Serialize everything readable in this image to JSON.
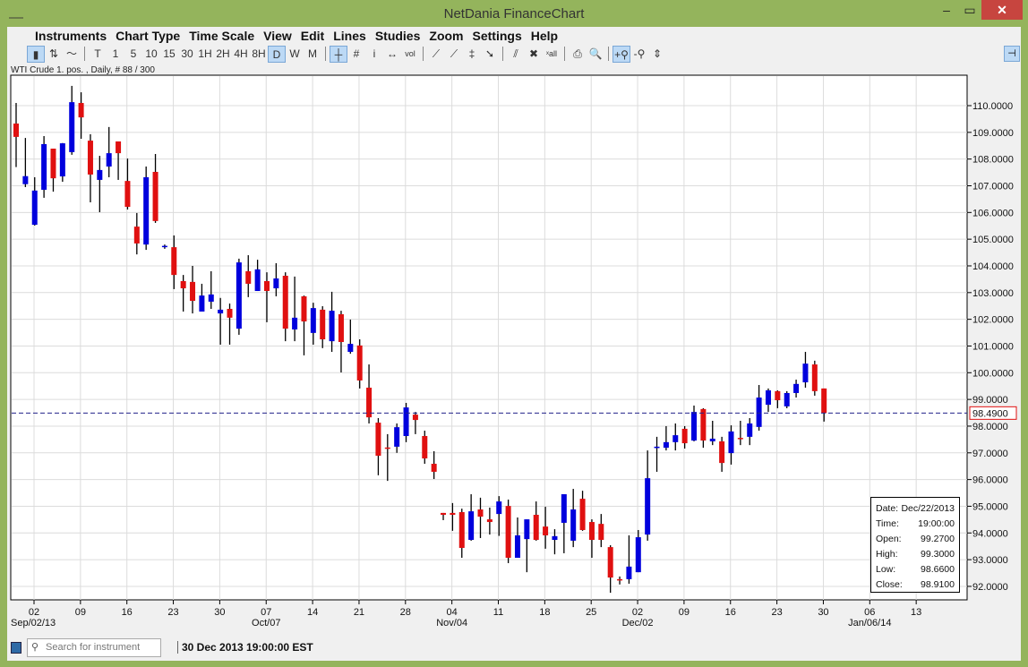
{
  "window": {
    "title": "NetDania FinanceChart",
    "minimize": "–",
    "maximize": "▭",
    "close": "✕"
  },
  "menu": [
    "Instruments",
    "Chart Type",
    "Time Scale",
    "View",
    "Edit",
    "Lines",
    "Studies",
    "Zoom",
    "Settings",
    "Help"
  ],
  "toolbar": {
    "chart_types": [
      {
        "icon": "candlestick-icon",
        "glyph": "▮",
        "on": true
      },
      {
        "icon": "bar-chart-icon",
        "glyph": "⇅"
      },
      {
        "icon": "line-chart-icon",
        "glyph": "〜"
      }
    ],
    "time_scales": [
      {
        "label": "T"
      },
      {
        "label": "1"
      },
      {
        "label": "5"
      },
      {
        "label": "10"
      },
      {
        "label": "15"
      },
      {
        "label": "30"
      },
      {
        "label": "1H"
      },
      {
        "label": "2H"
      },
      {
        "label": "4H"
      },
      {
        "label": "8H"
      },
      {
        "label": "D",
        "on": true
      },
      {
        "label": "W"
      },
      {
        "label": "M"
      }
    ],
    "tools": [
      {
        "icon": "crosshair-icon",
        "glyph": "┼",
        "on": true
      },
      {
        "icon": "grid-icon",
        "glyph": "#"
      },
      {
        "icon": "info-icon",
        "glyph": "i"
      },
      {
        "icon": "scroll-icon",
        "glyph": "↔"
      },
      {
        "icon": "volume-icon",
        "glyph": "vol"
      }
    ],
    "lines": [
      {
        "icon": "trendline-icon",
        "glyph": "⟋"
      },
      {
        "icon": "channel-icon",
        "glyph": "⟋"
      },
      {
        "icon": "fibonacci-icon",
        "glyph": "‡"
      },
      {
        "icon": "arrow-icon",
        "glyph": "➘"
      }
    ],
    "edit": [
      {
        "icon": "line-style-icon",
        "glyph": "⫽"
      },
      {
        "icon": "delete-icon",
        "glyph": "✖"
      },
      {
        "icon": "delete-all-icon",
        "glyph": "ˣall"
      }
    ],
    "view": [
      {
        "icon": "print-icon",
        "glyph": "⎙"
      },
      {
        "icon": "print-preview-icon",
        "glyph": "🔍"
      }
    ],
    "zoom": [
      {
        "icon": "zoom-in-icon",
        "glyph": "+⚲",
        "on": true
      },
      {
        "icon": "zoom-out-icon",
        "glyph": "-⚲"
      },
      {
        "icon": "fit-icon",
        "glyph": "⇕"
      }
    ]
  },
  "status_line": "WTI Crude 1. pos. , Daily, # 88 / 300",
  "chart_data": {
    "type": "candlestick",
    "instrument": "WTI Crude 1. pos.",
    "ohlc_format": [
      "open",
      "high",
      "low",
      "close"
    ],
    "candles": [
      [
        109.33,
        110.1,
        107.7,
        108.83
      ],
      [
        107.06,
        108.79,
        106.95,
        107.36
      ],
      [
        105.54,
        107.32,
        105.51,
        106.82
      ],
      [
        106.85,
        108.86,
        106.55,
        108.56
      ],
      [
        108.39,
        108.39,
        106.78,
        107.28
      ],
      [
        107.35,
        108.6,
        107.15,
        108.59
      ],
      [
        108.26,
        110.74,
        108.16,
        110.13
      ],
      [
        110.1,
        110.5,
        108.76,
        109.56
      ],
      [
        108.69,
        108.93,
        106.38,
        107.42
      ],
      [
        107.22,
        108.12,
        106.01,
        107.59
      ],
      [
        107.72,
        109.2,
        107.32,
        108.22
      ],
      [
        108.66,
        108.66,
        107.22,
        108.22
      ],
      [
        107.18,
        108.02,
        106.11,
        106.21
      ],
      [
        105.47,
        105.98,
        104.43,
        104.84
      ],
      [
        104.8,
        107.72,
        104.6,
        107.32
      ],
      [
        107.52,
        108.19,
        105.61,
        105.68
      ],
      [
        104.73,
        104.8,
        104.64,
        104.75
      ],
      [
        104.7,
        105.14,
        103.13,
        103.66
      ],
      [
        103.43,
        103.66,
        102.29,
        103.16
      ],
      [
        103.4,
        104.0,
        102.22,
        102.69
      ],
      [
        102.29,
        103.33,
        102.29,
        102.89
      ],
      [
        102.66,
        103.8,
        102.39,
        102.93
      ],
      [
        102.22,
        102.8,
        101.05,
        102.36
      ],
      [
        102.39,
        102.59,
        101.05,
        102.06
      ],
      [
        101.65,
        104.27,
        101.42,
        104.13
      ],
      [
        103.8,
        104.4,
        102.83,
        103.33
      ],
      [
        103.06,
        104.23,
        103.06,
        103.87
      ],
      [
        103.43,
        103.76,
        101.89,
        103.06
      ],
      [
        103.16,
        104.1,
        102.86,
        103.53
      ],
      [
        103.63,
        103.76,
        101.18,
        101.65
      ],
      [
        101.62,
        103.6,
        101.18,
        102.06
      ],
      [
        102.86,
        102.89,
        100.65,
        101.92
      ],
      [
        101.49,
        102.62,
        101.05,
        102.42
      ],
      [
        102.36,
        102.49,
        100.92,
        101.25
      ],
      [
        101.18,
        103.03,
        100.78,
        102.32
      ],
      [
        102.19,
        102.32,
        100.01,
        101.15
      ],
      [
        100.78,
        101.99,
        100.71,
        101.08
      ],
      [
        101.02,
        101.25,
        99.41,
        99.71
      ],
      [
        99.44,
        100.31,
        98.1,
        98.33
      ],
      [
        98.13,
        98.3,
        96.16,
        96.89
      ],
      [
        97.2,
        97.7,
        95.95,
        97.18
      ],
      [
        97.23,
        98.1,
        97.0,
        97.96
      ],
      [
        97.63,
        98.87,
        97.4,
        98.7
      ],
      [
        98.43,
        98.53,
        97.7,
        98.23
      ],
      [
        97.63,
        97.83,
        96.59,
        96.79
      ],
      [
        96.59,
        97.06,
        96.02,
        96.29
      ],
      [
        94.75,
        94.75,
        94.48,
        94.68
      ],
      [
        94.75,
        95.12,
        94.08,
        94.68
      ],
      [
        94.78,
        94.91,
        93.07,
        93.44
      ],
      [
        93.74,
        95.45,
        93.71,
        94.81
      ],
      [
        94.88,
        95.32,
        93.81,
        94.61
      ],
      [
        94.51,
        94.95,
        93.94,
        94.41
      ],
      [
        94.71,
        95.38,
        93.89,
        95.18
      ],
      [
        95.01,
        95.25,
        92.87,
        93.07
      ],
      [
        93.07,
        94.58,
        93.07,
        93.91
      ],
      [
        93.77,
        94.51,
        92.53,
        94.51
      ],
      [
        94.68,
        95.18,
        93.71,
        93.74
      ],
      [
        94.24,
        94.98,
        93.41,
        93.91
      ],
      [
        93.74,
        94.14,
        93.2,
        93.88
      ],
      [
        94.38,
        95.45,
        93.24,
        95.45
      ],
      [
        93.71,
        95.65,
        93.47,
        94.88
      ],
      [
        95.28,
        95.58,
        94.08,
        94.11
      ],
      [
        94.41,
        94.51,
        93.07,
        93.74
      ],
      [
        94.34,
        94.71,
        93.47,
        93.74
      ],
      [
        93.47,
        93.54,
        91.76,
        92.33
      ],
      [
        92.27,
        92.37,
        92.07,
        92.25
      ],
      [
        92.27,
        93.91,
        92.1,
        92.74
      ],
      [
        92.53,
        94.11,
        92.53,
        93.84
      ],
      [
        93.94,
        97.09,
        93.71,
        96.05
      ],
      [
        97.2,
        97.6,
        96.29,
        97.23
      ],
      [
        97.19,
        98.0,
        97.09,
        97.4
      ],
      [
        97.4,
        98.1,
        97.09,
        97.66
      ],
      [
        97.9,
        98.0,
        97.16,
        97.36
      ],
      [
        97.46,
        98.77,
        97.43,
        98.53
      ],
      [
        98.64,
        98.67,
        97.19,
        97.46
      ],
      [
        97.43,
        98.2,
        97.29,
        97.53
      ],
      [
        97.43,
        97.6,
        96.29,
        96.62
      ],
      [
        96.99,
        98.03,
        96.56,
        97.8
      ],
      [
        97.56,
        98.2,
        97.29,
        97.53
      ],
      [
        97.6,
        98.3,
        97.29,
        98.1
      ],
      [
        97.97,
        99.54,
        97.83,
        99.07
      ],
      [
        98.8,
        99.41,
        98.53,
        99.34
      ],
      [
        99.31,
        99.34,
        98.67,
        98.97
      ],
      [
        98.74,
        99.31,
        98.67,
        99.24
      ],
      [
        99.24,
        99.74,
        99.07,
        99.58
      ],
      [
        99.64,
        100.78,
        99.44,
        100.34
      ],
      [
        100.31,
        100.45,
        99.14,
        99.31
      ],
      [
        99.41,
        99.41,
        98.17,
        98.49
      ]
    ],
    "up_color": "#0000dd",
    "down_color": "#e01010",
    "ylim": [
      91.5,
      111
    ],
    "y_ticks": [
      "92.0000",
      "93.0000",
      "94.0000",
      "95.0000",
      "96.0000",
      "97.0000",
      "98.0000",
      "99.0000",
      "100.0000",
      "101.0000",
      "102.0000",
      "103.0000",
      "104.0000",
      "105.0000",
      "106.0000",
      "107.0000",
      "108.0000",
      "109.0000",
      "110.0000"
    ],
    "x_ticks": [
      "02",
      "09",
      "16",
      "23",
      "30",
      "07",
      "14",
      "21",
      "28",
      "04",
      "11",
      "18",
      "25",
      "02",
      "09",
      "16",
      "23",
      "30",
      "06",
      "13"
    ],
    "x_months": [
      {
        "tick": 0,
        "label": "Sep/02/13"
      },
      {
        "tick": 5,
        "label": "Oct/07"
      },
      {
        "tick": 9,
        "label": "Nov/04"
      },
      {
        "tick": 13,
        "label": "Dec/02"
      },
      {
        "tick": 18,
        "label": "Jan/06/14"
      }
    ],
    "current_price": 98.49,
    "current_price_label": "98.4900",
    "grid": true
  },
  "infobox": {
    "date_label": "Date:",
    "date": "Dec/22/2013",
    "time_label": "Time:",
    "time": "19:00:00",
    "open_label": "Open:",
    "open": "99.2700",
    "high_label": "High:",
    "high": "99.3000",
    "low_label": "Low:",
    "low": "98.6600",
    "close_label": "Close:",
    "close": "98.9100"
  },
  "bottom": {
    "search_placeholder": "Search for instrument",
    "datetime": "30 Dec 2013 19:00:00 EST"
  }
}
